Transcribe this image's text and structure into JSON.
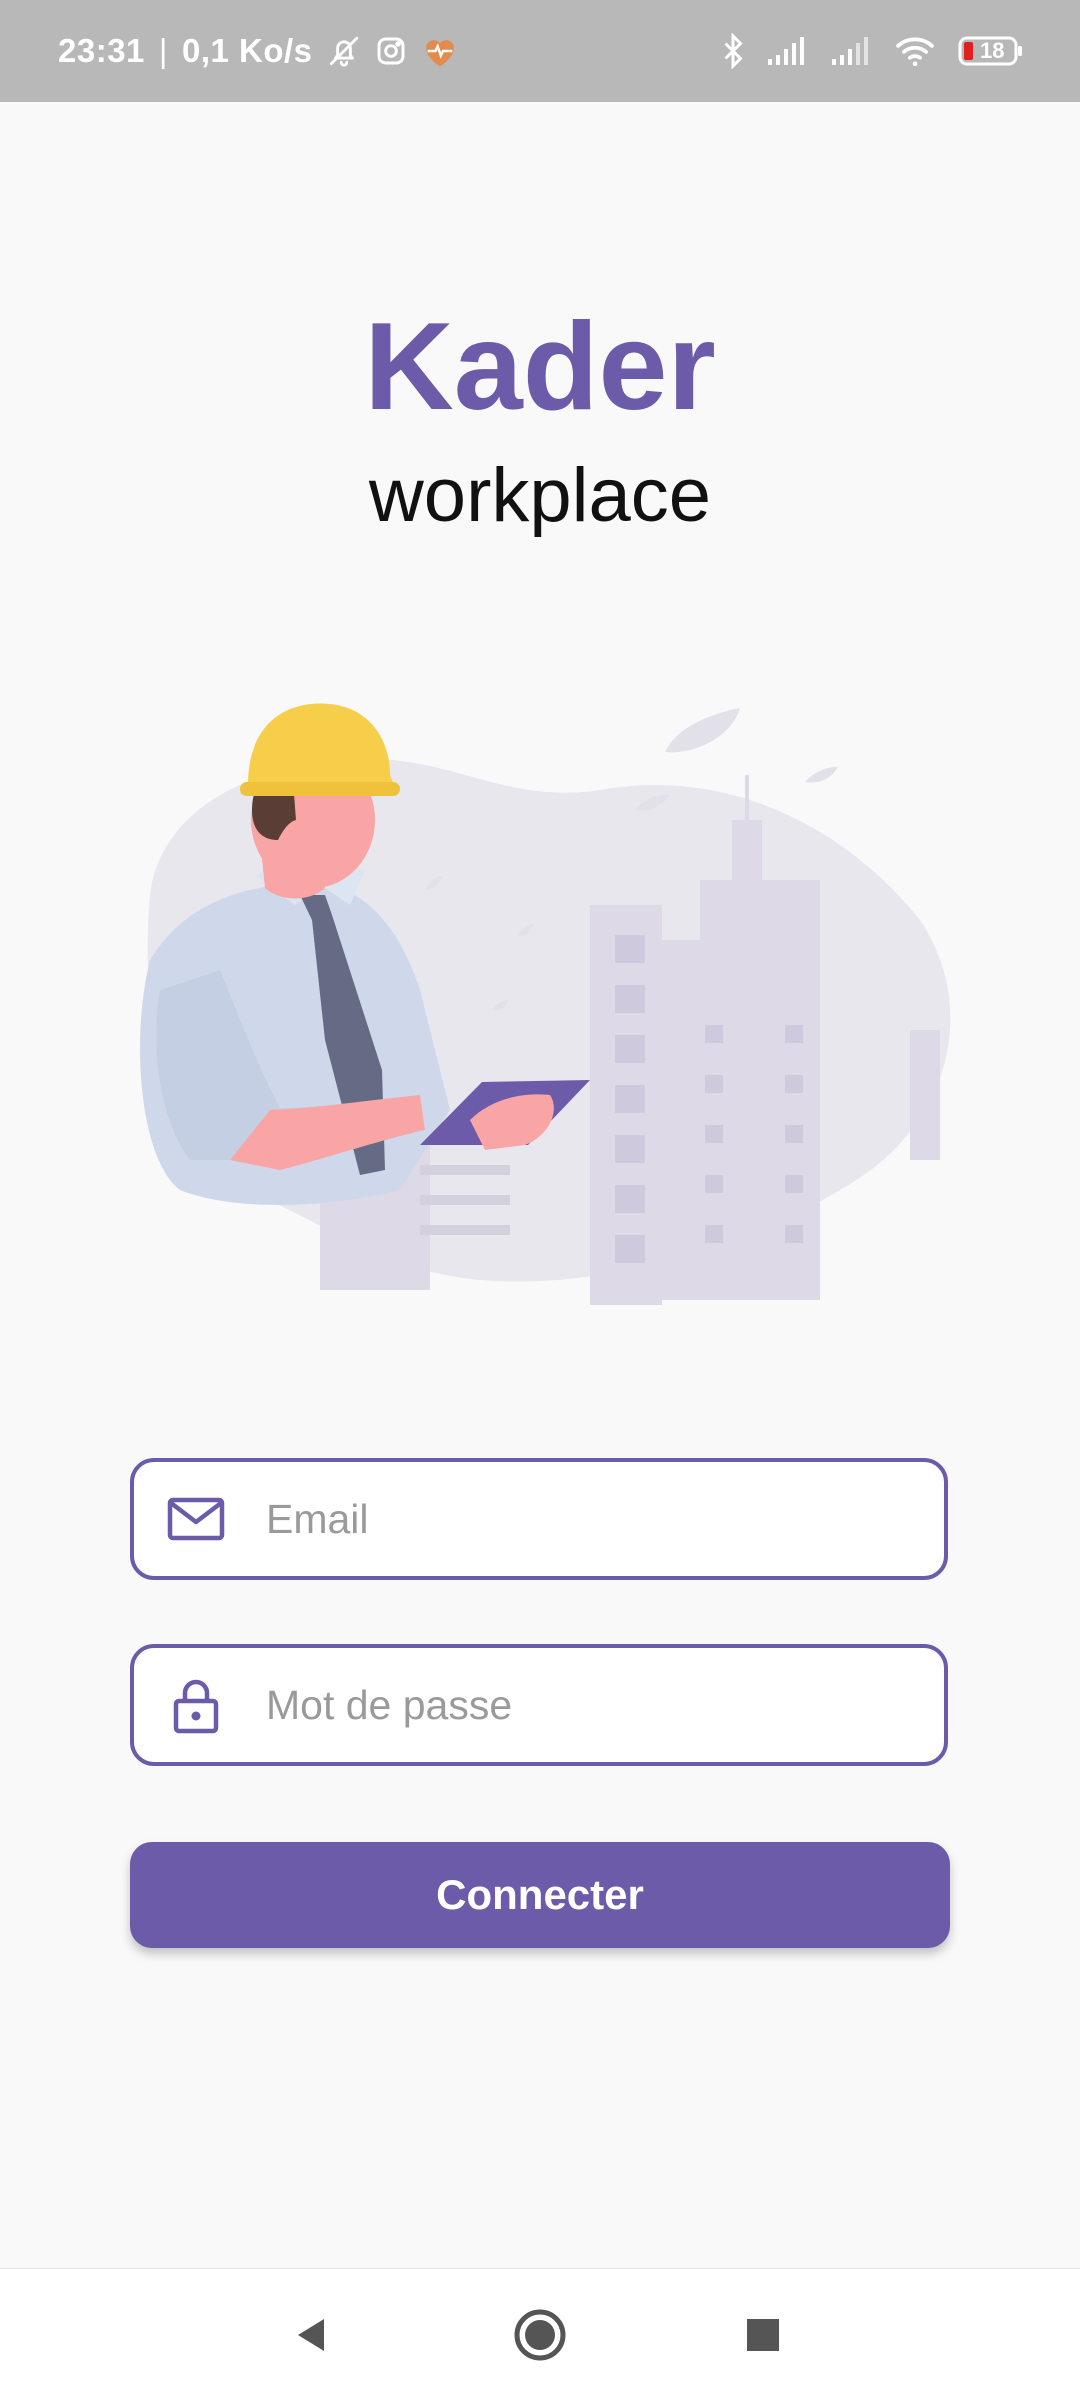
{
  "status_bar": {
    "time": "23:31",
    "separator": "|",
    "speed": "0,1 Ko/s",
    "battery": "18",
    "icons": [
      "bell-off-icon",
      "instagram-icon",
      "heart-rate-icon",
      "bluetooth-icon",
      "signal-icon",
      "signal-icon-2",
      "wifi-icon",
      "battery-icon"
    ]
  },
  "brand": {
    "title": "Kader",
    "subtitle": "workplace"
  },
  "form": {
    "email_placeholder": "Email",
    "email_value": "",
    "password_placeholder": "Mot de passe",
    "password_value": "",
    "submit_label": "Connecter"
  },
  "colors": {
    "accent": "#6b5ba8",
    "background": "#f9f9f9",
    "status_bar": "#b8b8b8"
  },
  "nav_bar": {
    "icons": [
      "back-icon",
      "home-icon",
      "recents-icon"
    ]
  }
}
